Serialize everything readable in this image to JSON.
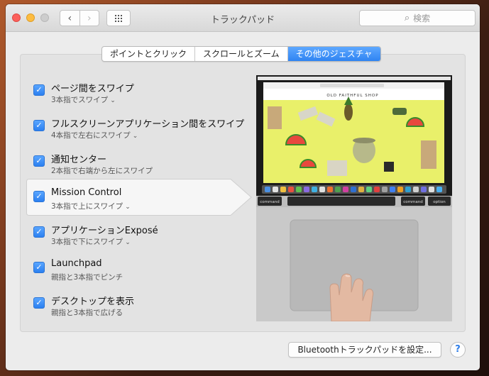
{
  "window": {
    "title": "トラックパッド",
    "search_placeholder": "検索"
  },
  "tabs": [
    {
      "label": "ポイントとクリック",
      "active": false
    },
    {
      "label": "スクロールとズーム",
      "active": false
    },
    {
      "label": "その他のジェスチャ",
      "active": true
    }
  ],
  "gestures": [
    {
      "title": "ページ間をスワイプ",
      "sub": "3本指でスワイプ",
      "has_menu": true,
      "checked": true
    },
    {
      "title": "フルスクリーンアプリケーション間をスワイプ",
      "sub": "4本指で左右にスワイプ",
      "has_menu": true,
      "checked": true
    },
    {
      "title": "通知センター",
      "sub": "2本指で右端から左にスワイプ",
      "has_menu": false,
      "checked": true
    },
    {
      "title": "Mission Control",
      "sub": "3本指で上にスワイプ",
      "has_menu": true,
      "checked": true,
      "selected": true
    },
    {
      "title": "アプリケーションExposé",
      "sub": "3本指で下にスワイプ",
      "has_menu": true,
      "checked": true
    },
    {
      "title": "Launchpad",
      "sub": "親指と3本指でピンチ",
      "has_menu": false,
      "checked": true
    },
    {
      "title": "デスクトップを表示",
      "sub": "親指と3本指で広げる",
      "has_menu": false,
      "checked": true
    }
  ],
  "preview": {
    "shop_name": "OLD FAITHFUL SHOP",
    "key_left": "command",
    "key_right1": "command",
    "key_right2": "option"
  },
  "footer": {
    "bluetooth_button": "Bluetoothトラックパッドを設定...",
    "help": "?"
  },
  "colors": {
    "accent": "#2f84f2",
    "preview_yellow": "#e9f06a"
  }
}
